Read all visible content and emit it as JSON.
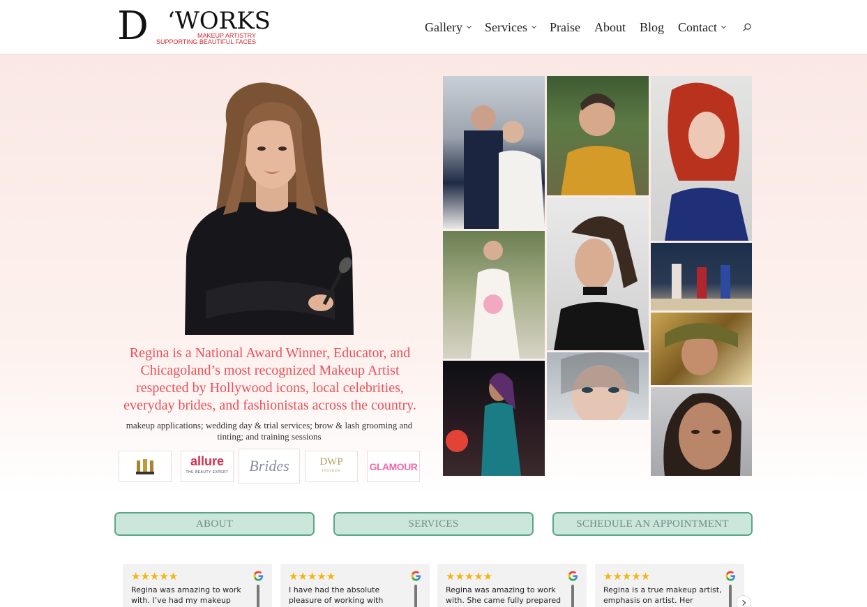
{
  "logo": {
    "letter": "D",
    "apostrophe": "‘",
    "word": "WORKS",
    "tagline1": "MAKEUP ARTISTRY",
    "tagline2": "SUPPORTING BEAUTIFUL FACES"
  },
  "nav": {
    "items": [
      {
        "label": "Gallery",
        "dropdown": true
      },
      {
        "label": "Services",
        "dropdown": true
      },
      {
        "label": "Praise",
        "dropdown": false
      },
      {
        "label": "About",
        "dropdown": false
      },
      {
        "label": "Blog",
        "dropdown": false
      },
      {
        "label": "Contact",
        "dropdown": true
      }
    ],
    "search_icon": "search-icon"
  },
  "hero": {
    "intro": "Regina is a National Award Winner, Educator, and Chicagoland’s most recognized Makeup Artist respected by Hollywood icons, local celebrities, everyday brides, and fashionistas across the country.",
    "services": "makeup applications; wedding day & trial services; brow & lash grooming and tinting; and training sessions"
  },
  "press": {
    "allure": "allure",
    "allure_sub": "THE BEAUTY EXPERT",
    "brides": "Brides",
    "dwp": "DWP",
    "dwp_sub": "INSIDER",
    "glamour": "GLAMOUR"
  },
  "buttons": {
    "about": "ABOUT",
    "services": "SERVICES",
    "schedule": "SCHEDULE AN APPOINTMENT"
  },
  "reviews": [
    {
      "stars": "★★★★★",
      "text": "Regina was amazing to work with. I’ve had my makeup done"
    },
    {
      "stars": "★★★★★",
      "text": "I have had the absolute pleasure of working with Regina"
    },
    {
      "stars": "★★★★★",
      "text": "Regina was amazing to work with. She came fully prepared"
    },
    {
      "stars": "★★★★★",
      "text": "Regina is a true makeup artist, emphasis on artist. Her attention"
    }
  ],
  "colors": {
    "accent": "#e8525a",
    "button_bg": "#cbe7dc",
    "button_border": "#5aa687",
    "star": "#f5b40d"
  }
}
